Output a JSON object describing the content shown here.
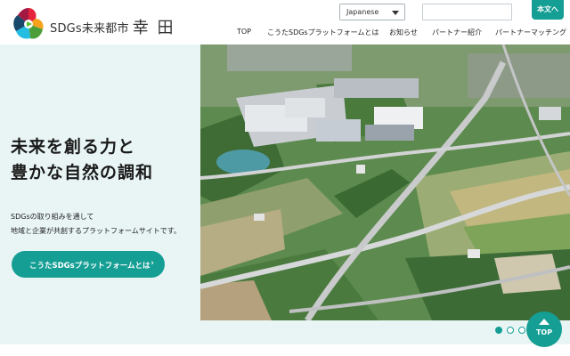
{
  "header": {
    "site_name": "SDGs未来都市",
    "city_name": "幸 田",
    "language": "Japanese",
    "text_button": "本文へ"
  },
  "nav": {
    "items": [
      "TOP",
      "こうたSDGsプラットフォームとは",
      "お知らせ",
      "パートナー紹介",
      "パートナーマッチング"
    ]
  },
  "hero": {
    "title_line1": "未来を創る力と",
    "title_line2": "豊かな自然の調和",
    "desc_line1": "SDGsの取り組みを通して",
    "desc_line2": "地域と企業が共創するプラットフォームサイトです。",
    "cta_label": "こうたSDGsプラットフォームとは",
    "cta_chevron": "›"
  },
  "slider": {
    "count": 3,
    "active_index": 0
  },
  "top_button": {
    "label": "TOP"
  },
  "colors": {
    "accent": "#159e94",
    "hero_bg": "#e9f5f5"
  },
  "icons": {
    "logo": "sdgs-wheel-logo",
    "language": "chevron-down-icon",
    "top": "arrow-up-icon"
  }
}
